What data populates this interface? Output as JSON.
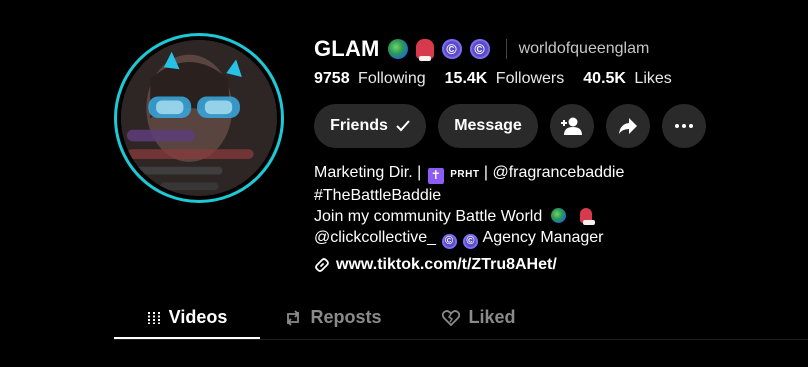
{
  "profile": {
    "display_name": "GLAM",
    "username": "worldofqueenglam"
  },
  "stats": {
    "following_count": "9758",
    "following_label": "Following",
    "followers_count": "15.4K",
    "followers_label": "Followers",
    "likes_count": "40.5K",
    "likes_label": "Likes"
  },
  "actions": {
    "friends_label": "Friends",
    "message_label": "Message"
  },
  "bio": {
    "line1_prefix": "Marketing Dir. |",
    "line1_badge": "PRHT",
    "line1_suffix": "| @fragrancebaddie",
    "line2": "#TheBattleBaddie",
    "line3": "Join my community Battle World",
    "line4_prefix": "@clickcollective_",
    "line4_suffix": "Agency Manager"
  },
  "link": {
    "url": "www.tiktok.com/t/ZTru8AHet/"
  },
  "tabs": [
    {
      "label": "Videos",
      "active": true
    },
    {
      "label": "Reposts",
      "active": false
    },
    {
      "label": "Liked",
      "active": false
    }
  ],
  "colors": {
    "background": "#000000",
    "avatar_ring": "#1ec9d6",
    "button_bg": "#2a2a2a",
    "badge_purple": "#5b4cc9",
    "inactive_tab": "#8a8a8a"
  },
  "icons": [
    "globe-icon",
    "boxing-glove-icon",
    "copyright-icon",
    "check-icon",
    "add-user-icon",
    "share-icon",
    "more-icon",
    "link-icon",
    "grid-icon",
    "repost-icon",
    "heart-icon"
  ]
}
